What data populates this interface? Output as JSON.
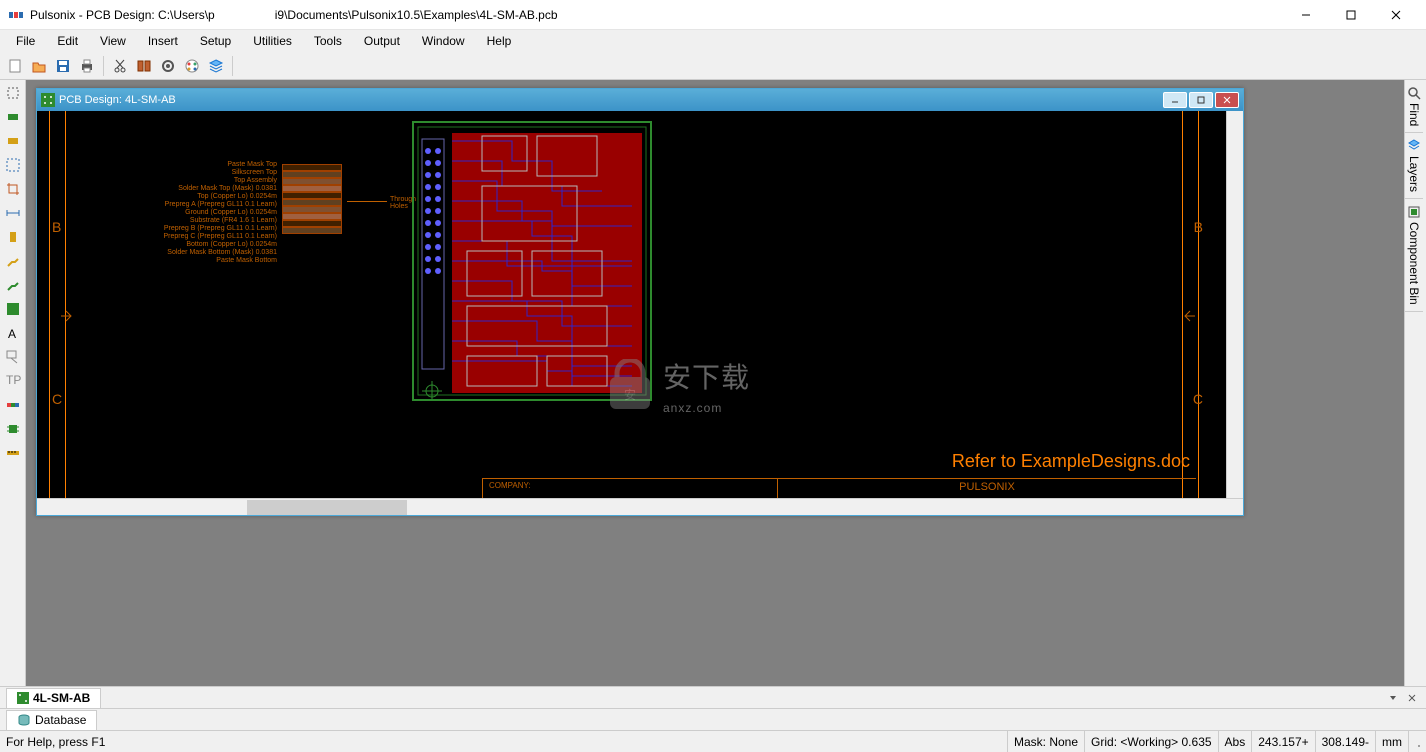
{
  "titlebar": {
    "app_title": "Pulsonix - PCB Design: C:\\Users\\p",
    "path_suffix": "i9\\Documents\\Pulsonix10.5\\Examples\\4L-SM-AB.pcb"
  },
  "menu": {
    "file": "File",
    "edit": "Edit",
    "view": "View",
    "insert": "Insert",
    "setup": "Setup",
    "utilities": "Utilities",
    "tools": "Tools",
    "output": "Output",
    "window": "Window",
    "help": "Help"
  },
  "child_window": {
    "title": "PCB Design: 4L-SM-AB"
  },
  "canvas": {
    "refer_text": "Refer to ExampleDesigns.doc",
    "row_b": "B",
    "row_c": "C",
    "company_label": "COMPANY:",
    "company_name": "PULSONIX",
    "through_holes": "Through Holes",
    "legend_lines": [
      "Paste Mask Top",
      "Silkscreen Top",
      "Top Assembly",
      "Solder Mask Top (Mask) 0.0381",
      "Top (Copper Lo) 0.0254m",
      "Prepreg A (Prepreg GL11 0.1 Learn)",
      "Ground (Copper Lo) 0.0254m",
      "Substrate (FR4 1.6 1 Learn)",
      "Prepreg B (Prepreg GL11 0.1 Learn)",
      "Prepreg C (Prepreg GL11 0.1 Learn)",
      "Bottom (Copper Lo) 0.0254m",
      "Solder Mask Bottom (Mask) 0.0381",
      "Paste Mask Bottom"
    ]
  },
  "right_dock": {
    "find": "Find",
    "layers": "Layers",
    "component_bin": "Component Bin"
  },
  "tabs": {
    "doc1": "4L-SM-AB",
    "database": "Database"
  },
  "status": {
    "help": "For Help, press F1",
    "mask": "Mask: None",
    "grid": "Grid: <Working> 0.635",
    "abs": "Abs",
    "x": "243.157+",
    "y": "308.149-",
    "unit": "mm"
  },
  "watermark": {
    "text_cn": "安下载",
    "text_url": "anxz.com"
  }
}
